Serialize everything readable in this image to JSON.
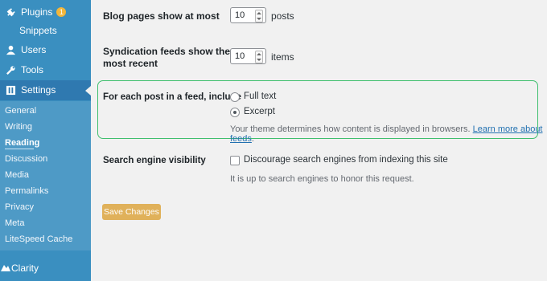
{
  "sidebar": {
    "items": {
      "plugins": {
        "label": "Plugins",
        "badge": "1"
      },
      "snippets": {
        "label": "Snippets"
      },
      "users": {
        "label": "Users"
      },
      "tools": {
        "label": "Tools"
      },
      "settings": {
        "label": "Settings"
      }
    },
    "submenu": [
      {
        "label": "General"
      },
      {
        "label": "Writing"
      },
      {
        "label": "Reading"
      },
      {
        "label": "Discussion"
      },
      {
        "label": "Media"
      },
      {
        "label": "Permalinks"
      },
      {
        "label": "Privacy"
      },
      {
        "label": "Meta"
      },
      {
        "label": "LiteSpeed Cache"
      }
    ],
    "clarity": {
      "label": "Clarity"
    }
  },
  "reading_settings": {
    "blog_pages": {
      "label": "Blog pages show at most",
      "value": "10",
      "unit": "posts"
    },
    "syndication": {
      "label_line1": "Syndication feeds show the",
      "label_line2": "most recent",
      "value": "10",
      "unit": "items"
    },
    "feed_include": {
      "label": "For each post in a feed, include",
      "options": [
        {
          "label": "Full text",
          "checked": false
        },
        {
          "label": "Excerpt",
          "checked": true
        }
      ],
      "description": "Your theme determines how content is displayed in browsers.",
      "link_text": "Learn more about feeds",
      "link_suffix": "."
    },
    "search_visibility": {
      "label": "Search engine visibility",
      "checkbox_label": "Discourage search engines from indexing this site",
      "note": "It is up to search engines to honor this request."
    },
    "save_label": "Save Changes"
  },
  "colors": {
    "sidebar": "#3a8fc0",
    "sidebar_active": "#2f79b0",
    "highlight_border": "#3fbf6e",
    "save_button": "#e0b15a",
    "link": "#2271b1"
  }
}
